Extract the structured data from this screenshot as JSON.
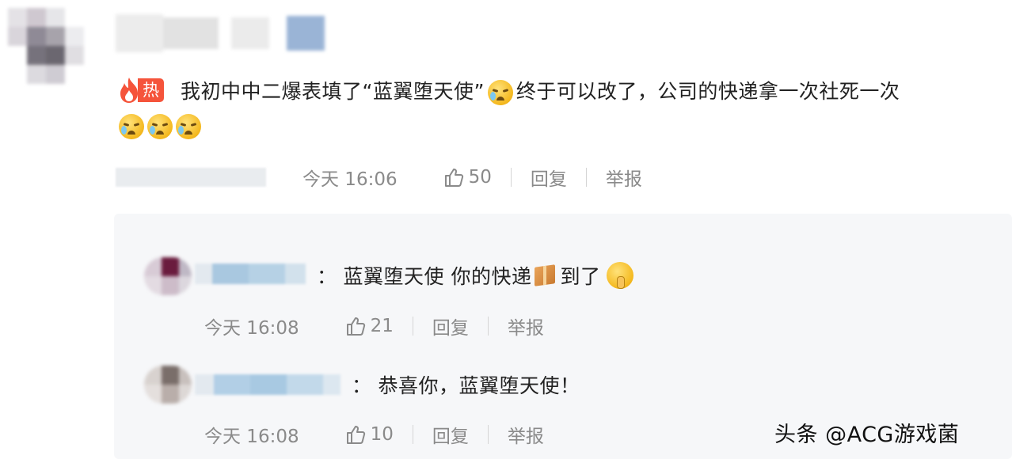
{
  "main_comment": {
    "hot_tag": "热",
    "text": "我初中中二爆表填了“蓝翼堕天使”",
    "text_after_emoji": "终于可以改了，公司的快递拿一次社死一次",
    "emoji": "crying-emoji",
    "time": "今天 16:06",
    "likes": "50",
    "reply_label": "回复",
    "report_label": "举报"
  },
  "replies": [
    {
      "separator": "：",
      "text": "蓝翼堕天使 你的快递",
      "text_after_icon": "到了",
      "time": "今天 16:08",
      "likes": "21",
      "reply_label": "回复",
      "report_label": "举报"
    },
    {
      "separator": "：",
      "text": "恭喜你，蓝翼堕天使！",
      "time": "今天 16:08",
      "likes": "10",
      "reply_label": "回复",
      "report_label": "举报"
    }
  ],
  "watermark": "头条 @ACG游戏菌",
  "colors": {
    "hot": "#f5543b",
    "meta": "#8a8a8a",
    "reply_bg": "#f6f7f9"
  }
}
